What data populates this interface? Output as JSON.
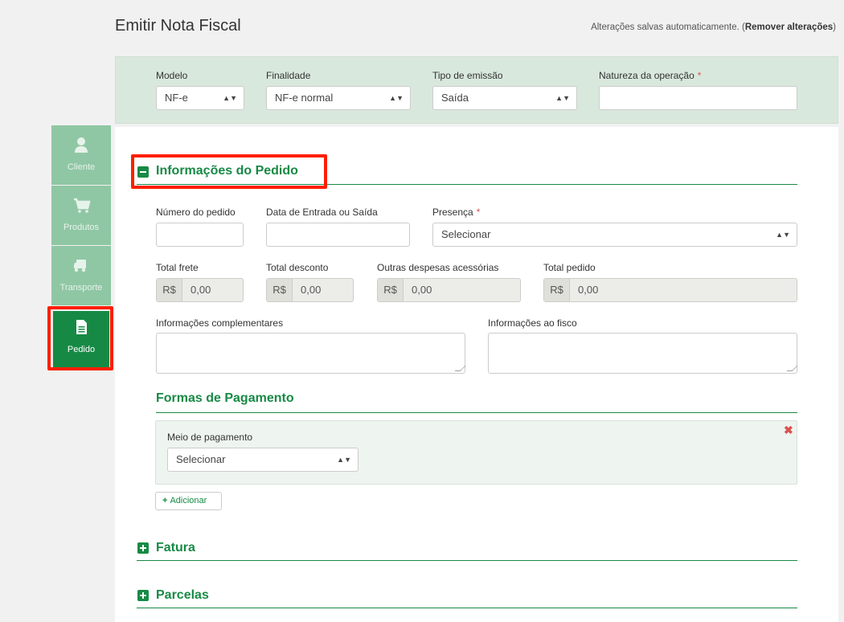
{
  "header": {
    "title": "Emitir Nota Fiscal",
    "autosave_text": "Alterações salvas automaticamente. (",
    "autosave_link": "Remover alterações",
    "autosave_close": ")"
  },
  "top_panel": {
    "modelo": {
      "label": "Modelo",
      "value": "NF-e"
    },
    "finalidade": {
      "label": "Finalidade",
      "value": "NF-e normal"
    },
    "tipo_emissao": {
      "label": "Tipo de emissão",
      "value": "Saída"
    },
    "natureza": {
      "label": "Natureza da operação",
      "required_mark": "*",
      "value": ""
    }
  },
  "sidebar": {
    "items": [
      {
        "label": "Cliente",
        "icon": "user-icon"
      },
      {
        "label": "Produtos",
        "icon": "cart-icon"
      },
      {
        "label": "Transporte",
        "icon": "truck-icon"
      },
      {
        "label": "Pedido",
        "icon": "document-icon",
        "active": true
      }
    ]
  },
  "pedido_section": {
    "title": "Informações do Pedido",
    "numero_pedido": {
      "label": "Número do pedido",
      "value": ""
    },
    "data_entrada_saida": {
      "label": "Data de Entrada ou Saída",
      "value": ""
    },
    "presenca": {
      "label": "Presença",
      "required_mark": "*",
      "value": "Selecionar"
    },
    "total_frete": {
      "label": "Total frete",
      "prefix": "R$",
      "value": "0,00"
    },
    "total_desconto": {
      "label": "Total desconto",
      "prefix": "R$",
      "value": "0,00"
    },
    "outras_despesas": {
      "label": "Outras despesas acessórias",
      "prefix": "R$",
      "value": "0,00"
    },
    "total_pedido": {
      "label": "Total pedido",
      "prefix": "R$",
      "value": "0,00"
    },
    "info_complementares": {
      "label": "Informações complementares",
      "value": ""
    },
    "info_fisco": {
      "label": "Informações ao fisco",
      "value": ""
    }
  },
  "pagamento": {
    "title": "Formas de Pagamento",
    "meio_label": "Meio de pagamento",
    "meio_value": "Selecionar",
    "remove_symbol": "✖",
    "add_label": "Adicionar"
  },
  "fatura": {
    "title": "Fatura"
  },
  "parcelas": {
    "title": "Parcelas"
  },
  "colors": {
    "accent": "#178a45",
    "sidebar_inactive": "#8fc7a4",
    "top_panel_bg": "#d9e8dd",
    "highlight": "#ff1e00",
    "required": "#d9534f"
  }
}
